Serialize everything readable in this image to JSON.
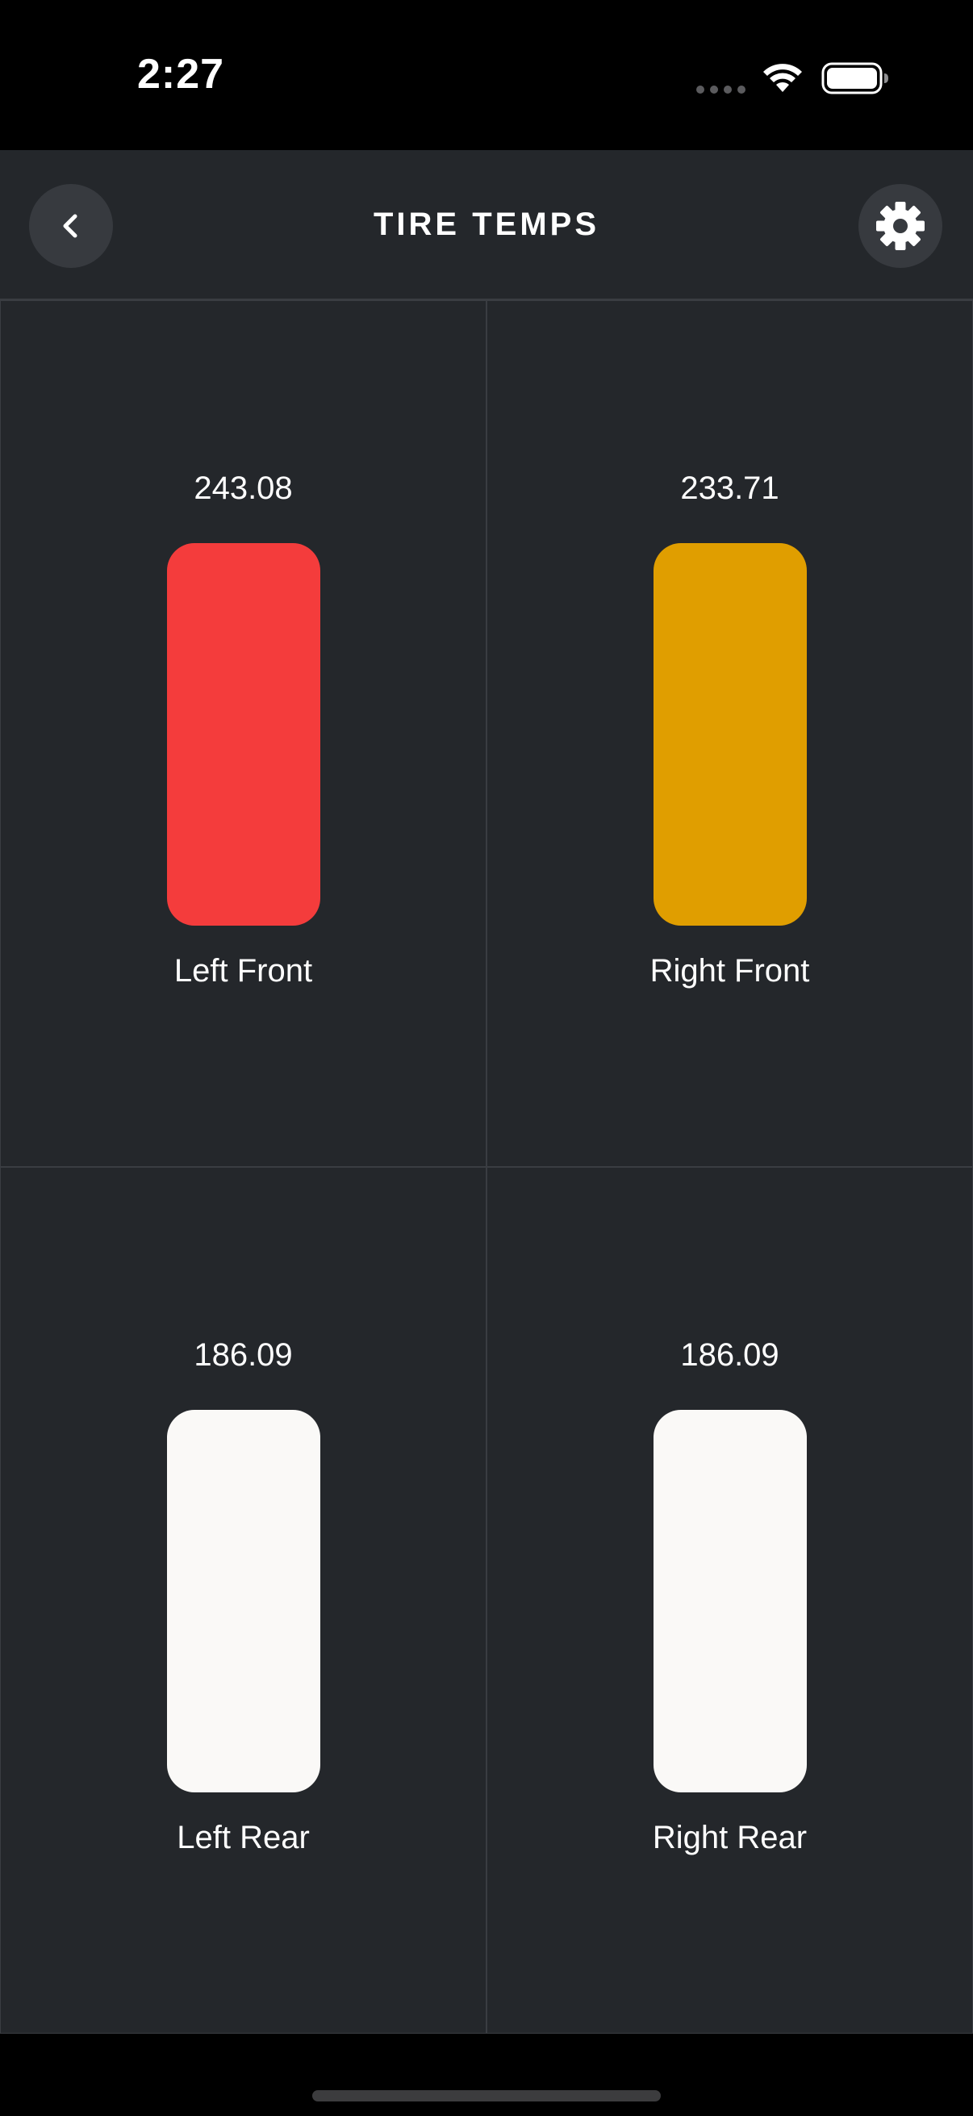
{
  "status_bar": {
    "time": "2:27"
  },
  "header": {
    "title": "TIRE TEMPS",
    "back_icon": "chevron-left-icon",
    "settings_icon": "gear-icon"
  },
  "tires": [
    {
      "label": "Left Front",
      "value": "243.08",
      "color": "#f43c3c"
    },
    {
      "label": "Right Front",
      "value": "233.71",
      "color": "#e09e00"
    },
    {
      "label": "Left Rear",
      "value": "186.09",
      "color": "#faf9f7"
    },
    {
      "label": "Right Rear",
      "value": "186.09",
      "color": "#faf9f7"
    }
  ],
  "colors": {
    "background": "#24272b",
    "header_button": "#373a3f",
    "grid_line": "#3a3d42"
  }
}
